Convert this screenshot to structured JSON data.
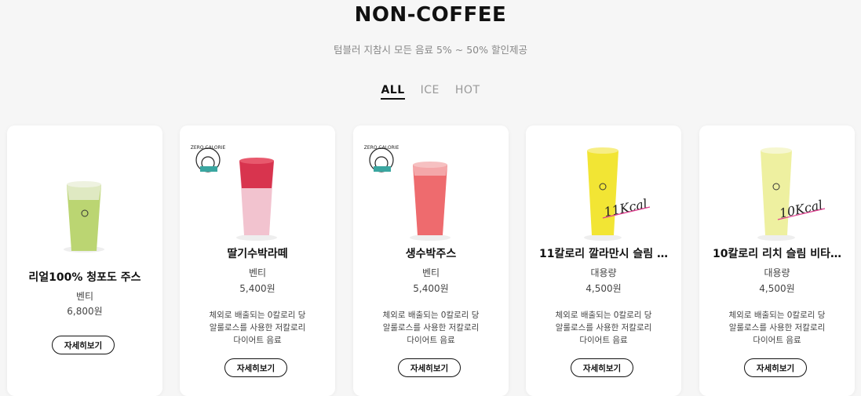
{
  "header": {
    "title": "NON-COFFEE",
    "subtitle": "텀블러 지참시 모든 음료 5% ~ 50% 할인제공"
  },
  "tabs": [
    {
      "label": "ALL",
      "active": true
    },
    {
      "label": "ICE",
      "active": false
    },
    {
      "label": "HOT",
      "active": false
    }
  ],
  "products": [
    {
      "name": "리얼100% 청포도 주스",
      "size": "벤티",
      "price": "6,800원",
      "desc": [],
      "button": "자세히보기",
      "drink_color": "#b7d36a",
      "badge": "none"
    },
    {
      "name": "딸기수박라떼",
      "size": "벤티",
      "price": "5,400원",
      "desc": [
        "체외로 배출되는 0칼로리 당",
        "알룰로스를 사용한 저칼로리",
        "다이어트 음료"
      ],
      "button": "자세히보기",
      "drink_color": "#e8596d",
      "badge": "zero-calorie"
    },
    {
      "name": "생수박주스",
      "size": "벤티",
      "price": "5,400원",
      "desc": [
        "체외로 배출되는 0칼로리 당",
        "알룰로스를 사용한 저칼로리",
        "다이어트 음료"
      ],
      "button": "자세히보기",
      "drink_color": "#ee6b6e",
      "badge": "zero-calorie"
    },
    {
      "name": "11칼로리 깔라만시 슬림 …",
      "size": "대용량",
      "price": "4,500원",
      "desc": [
        "체외로 배출되는 0칼로리 당",
        "알룰로스를 사용한 저칼로리",
        "다이어트 음료"
      ],
      "button": "자세히보기",
      "drink_color": "#f2e534",
      "badge": "kcal",
      "kcal_label": "11Kcal"
    },
    {
      "name": "10칼로리 리치 슬림 비타…",
      "size": "대용량",
      "price": "4,500원",
      "desc": [
        "체외로 배출되는 0칼로리 당",
        "알룰로스를 사용한 저칼로리",
        "다이어트 음료"
      ],
      "button": "자세히보기",
      "drink_color": "#eef0a0",
      "badge": "kcal",
      "kcal_label": "10Kcal"
    }
  ],
  "badge_text": "ZERO CALORIE"
}
